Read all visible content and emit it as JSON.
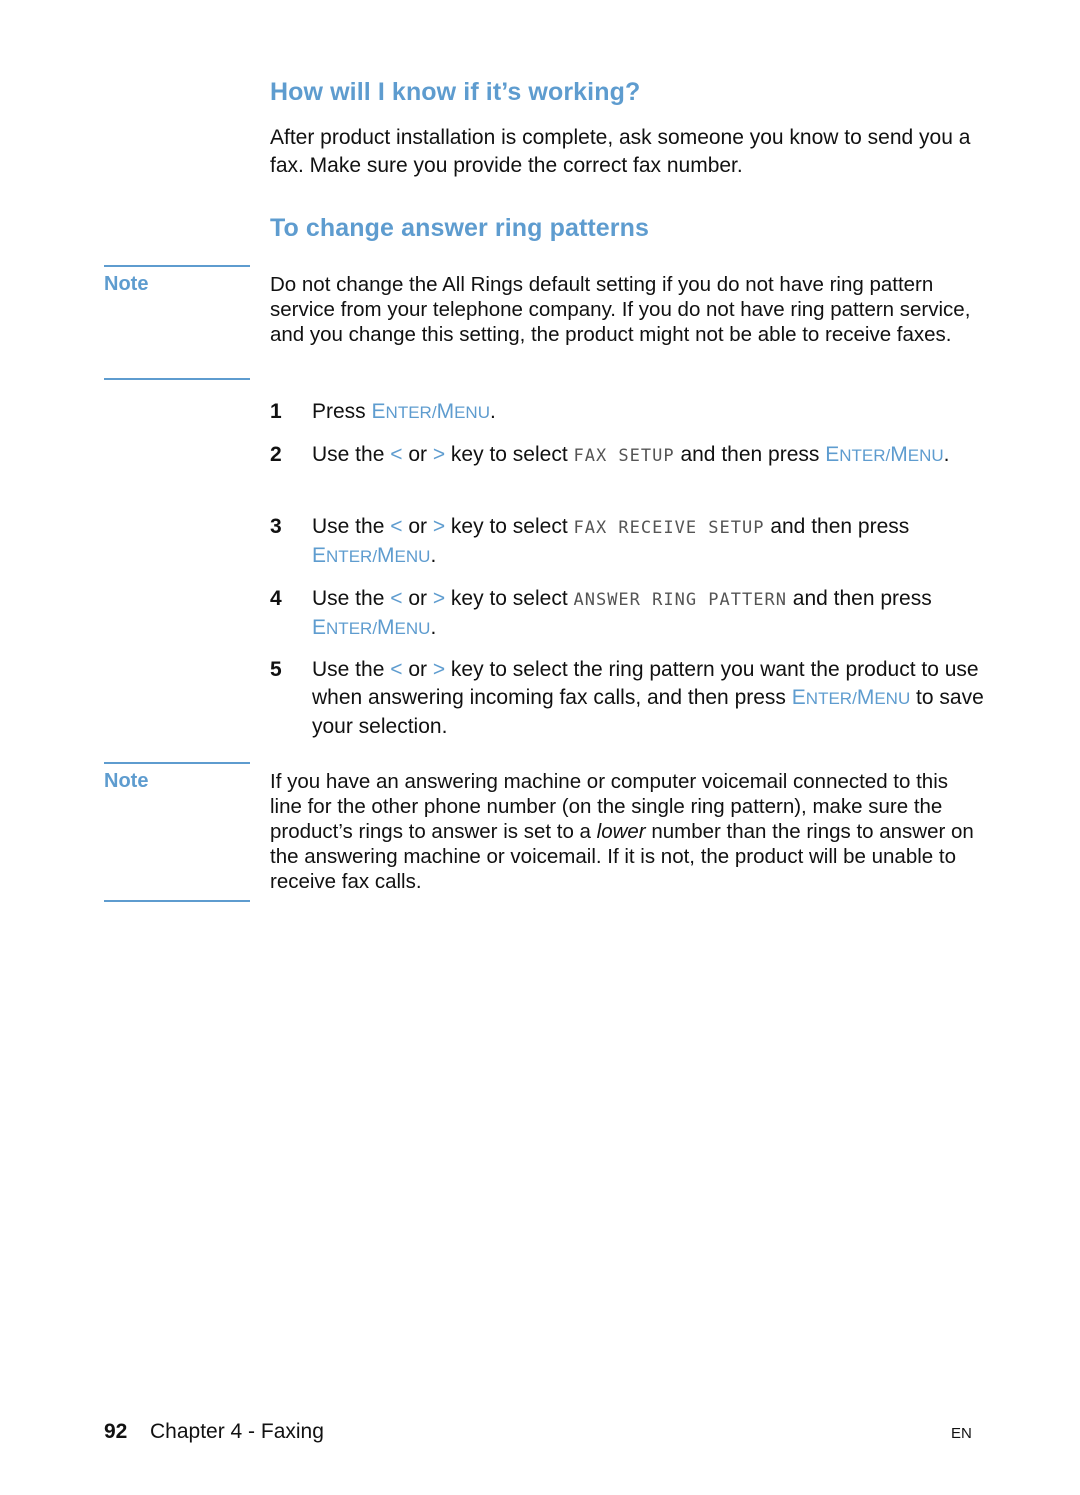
{
  "section1": {
    "heading": "How will I know if it’s working?",
    "body": "After product installation is complete, ask someone you know to send you a fax. Make sure you provide the correct fax number."
  },
  "section2": {
    "heading": "To change answer ring patterns",
    "note1": {
      "label": "Note",
      "text": "Do not change the All Rings default setting if you do not have ring pattern service from your telephone company. If you do not have ring pattern service, and you change this setting, the product might not be able to receive faxes."
    },
    "steps": [
      {
        "num": "1",
        "pre": "Press ",
        "key": "Enter/Menu",
        "post": "."
      },
      {
        "num": "2",
        "pre": "Use the ",
        "left": "<",
        "or": " or ",
        "right": ">",
        "mid": " key to select ",
        "lcd": "FAX SETUP",
        "after": " and then press ",
        "key": "Enter/Menu",
        "post": "."
      },
      {
        "num": "3",
        "pre": "Use the ",
        "left": "<",
        "or": " or ",
        "right": ">",
        "mid": " key to select ",
        "lcd": "FAX RECEIVE SETUP",
        "after": " and then press ",
        "key": "Enter/Menu",
        "post": "."
      },
      {
        "num": "4",
        "pre": "Use the ",
        "left": "<",
        "or": " or ",
        "right": ">",
        "mid": " key to select ",
        "lcd": "ANSWER RING PATTERN",
        "after": " and then press ",
        "key": "Enter/Menu",
        "post": "."
      },
      {
        "num": "5",
        "pre": "Use the ",
        "left": "<",
        "or": " or ",
        "right": ">",
        "mid": " key to select the ring pattern you want the product to use when answering incoming fax calls, and then press ",
        "key": "Enter/Menu",
        "post": " to save your selection."
      }
    ],
    "note2": {
      "label": "Note",
      "text_before": "If you have an answering machine or computer voicemail connected to this line for the other phone number (on the single ring pattern), make sure the product’s rings to answer is set to a ",
      "text_em": "lower",
      "text_after": " number than the rings to answer on the answering machine or voicemail. If it is not, the product will be unable to receive fax calls."
    }
  },
  "footer": {
    "page_number": "92",
    "chapter": "Chapter 4 - Faxing",
    "language": "EN"
  },
  "colors": {
    "accent": "#5e9ccf"
  }
}
